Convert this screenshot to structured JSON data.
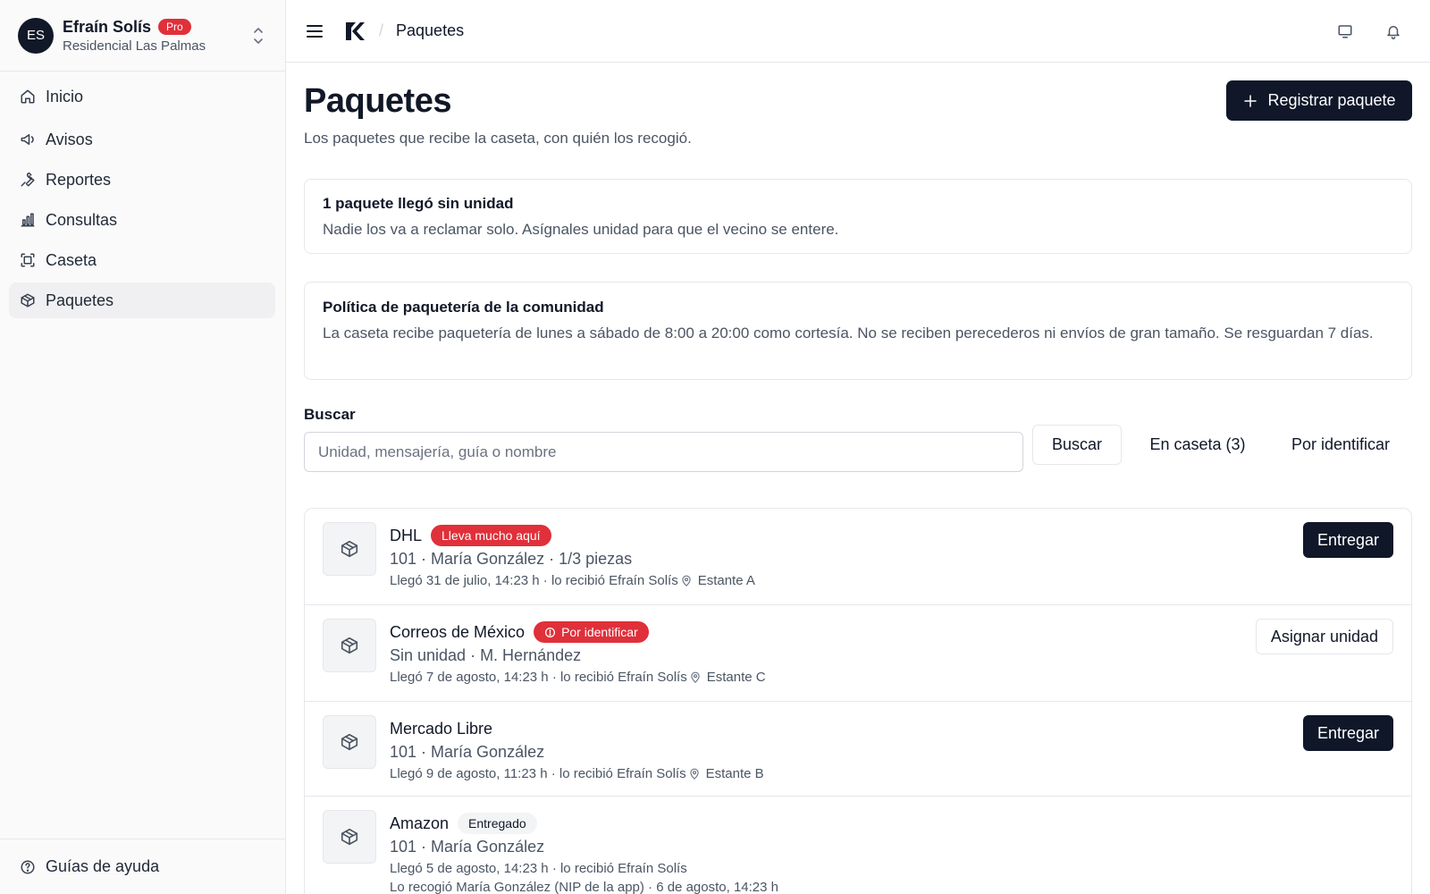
{
  "account": {
    "initials": "ES",
    "name": "Efraín Solís",
    "plan_badge": "Pro",
    "community": "Residencial Las Palmas"
  },
  "sidebar": {
    "items": [
      {
        "label": "Inicio",
        "icon": "home-icon"
      },
      {
        "label": "Avisos",
        "icon": "megaphone-icon"
      },
      {
        "label": "Reportes",
        "icon": "wrench-icon"
      },
      {
        "label": "Consultas",
        "icon": "bar-chart-icon"
      },
      {
        "label": "Caseta",
        "icon": "scan-icon"
      },
      {
        "label": "Paquetes",
        "icon": "package-icon",
        "active": true
      }
    ],
    "footer_label": "Guías de ayuda"
  },
  "topbar": {
    "breadcrumb": "Paquetes"
  },
  "page": {
    "title": "Paquetes",
    "subtitle": "Los paquetes que recibe la caseta, con quién los recogió.",
    "primary_action": "Registrar paquete"
  },
  "alert": {
    "title": "1 paquete llegó sin unidad",
    "body": "Nadie los va a reclamar solo. Asígnales unidad para que el vecino se entere."
  },
  "policy": {
    "title": "Política de paquetería de la comunidad",
    "body": "La caseta recibe paquetería de lunes a sábado de 8:00 a 20:00 como cortesía. No se reciben perecederos ni envíos de gran tamaño. Se resguardan 7 días."
  },
  "search": {
    "label": "Buscar",
    "placeholder": "Unidad, mensajería, guía o nombre",
    "button": "Buscar",
    "filter_in_booth": "En caseta (3)",
    "filter_unidentified": "Por identificar"
  },
  "packages": [
    {
      "carrier": "DHL",
      "badge": "Lleva mucho aquí",
      "line": "101 · María González · 1/3 piezas",
      "arrived": "Llegó 31 de julio, 14:23 h · lo recibió Efraín Solís",
      "location": "Estante A",
      "action": "Entregar"
    },
    {
      "carrier": "Correos de México",
      "badge": "Por identificar",
      "line": "Sin unidad · M. Hernández",
      "arrived": "Llegó 7 de agosto, 14:23 h · lo recibió Efraín Solís",
      "location": "Estante C",
      "action": "Asignar unidad"
    },
    {
      "carrier": "Mercado Libre",
      "line": "101 · María González",
      "arrived": "Llegó 9 de agosto, 11:23 h · lo recibió Efraín Solís",
      "location": "Estante B",
      "action": "Entregar"
    },
    {
      "carrier": "Amazon",
      "badge": "Entregado",
      "line": "101 · María González",
      "arrived": "Llegó 5 de agosto, 14:23 h · lo recibió Efraín Solís",
      "picked_up": "Lo recogió María González (NIP de la app) · 6 de agosto, 14:23 h"
    }
  ]
}
